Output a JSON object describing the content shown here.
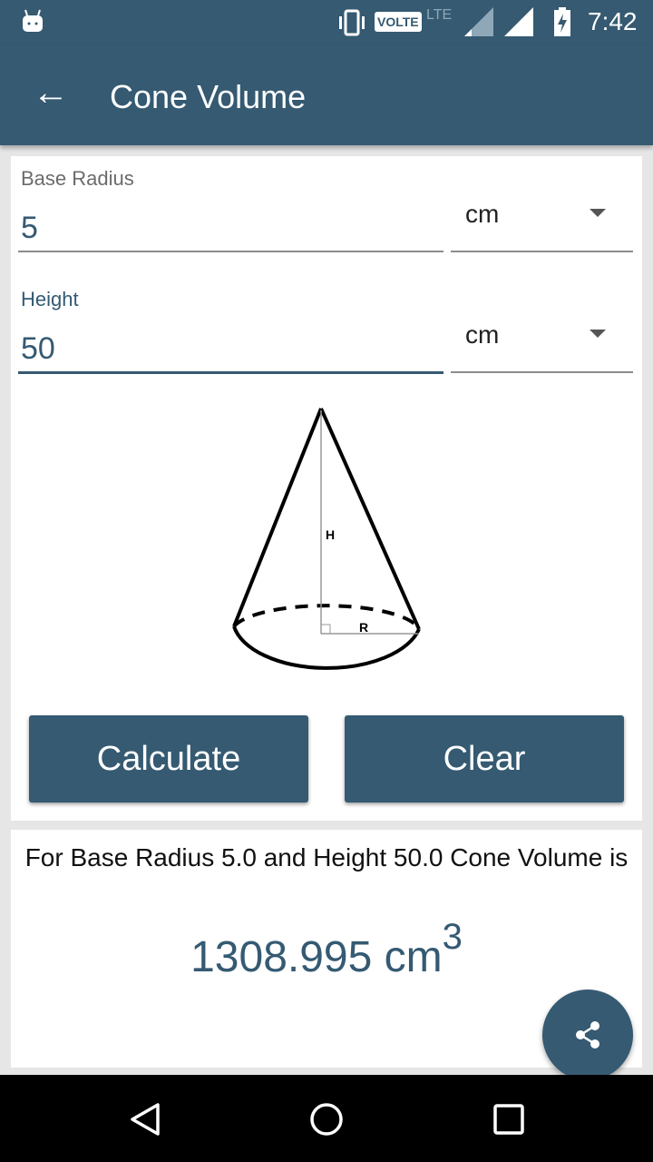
{
  "status_bar": {
    "time": "7:42",
    "volte": "VOLTE",
    "lte": "LTE"
  },
  "app_bar": {
    "title": "Cone Volume"
  },
  "form": {
    "radius": {
      "label": "Base Radius",
      "value": "5",
      "unit": "cm"
    },
    "height": {
      "label": "Height",
      "value": "50",
      "unit": "cm"
    }
  },
  "diagram": {
    "h_label": "H",
    "r_label": "R"
  },
  "buttons": {
    "calculate": "Calculate",
    "clear": "Clear"
  },
  "result": {
    "text": "For Base Radius 5.0 and Height 50.0 Cone Volume is",
    "value": "1308.995 cm",
    "exponent": "3"
  },
  "colors": {
    "primary": "#355a72"
  }
}
